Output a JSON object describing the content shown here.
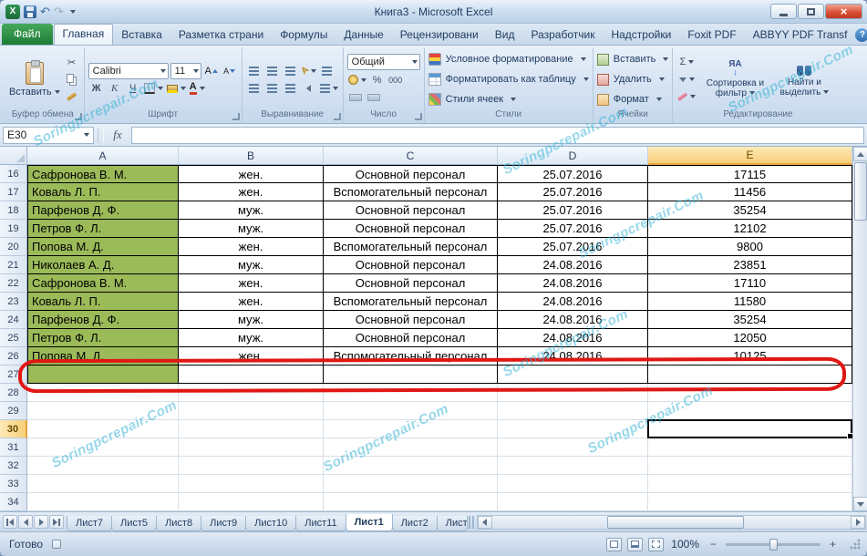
{
  "window": {
    "title": "Книга3  -  Microsoft Excel"
  },
  "icons": {
    "dropdown": "▾",
    "scissors": "✂",
    "undo": "↶",
    "redo": "↷",
    "close": "×",
    "help": "?",
    "sum": "Σ",
    "percent": "%",
    "zeros": "000",
    "letter_a": "А",
    "sort_letters": "ЯА",
    "down_arrow": "↓",
    "fx": "fx",
    "minus": "−",
    "plus": "+",
    "excel_x": "X"
  },
  "ribbon": {
    "tabs": [
      {
        "label": "Файл",
        "type": "file"
      },
      {
        "label": "Главная",
        "active": true
      },
      {
        "label": "Вставка"
      },
      {
        "label": "Разметка страни"
      },
      {
        "label": "Формулы"
      },
      {
        "label": "Данные"
      },
      {
        "label": "Рецензировани"
      },
      {
        "label": "Вид"
      },
      {
        "label": "Разработчик"
      },
      {
        "label": "Надстройки"
      },
      {
        "label": "Foxit PDF"
      },
      {
        "label": "ABBYY PDF Transf"
      }
    ],
    "clipboard": {
      "label": "Буфер обмена",
      "paste": "Вставить"
    },
    "font": {
      "label": "Шрифт",
      "family": "Calibri",
      "size": "11",
      "bold": "Ж",
      "italic": "К",
      "underline": "Ч"
    },
    "alignment": {
      "label": "Выравнивание"
    },
    "number": {
      "label": "Число",
      "format": "Общий"
    },
    "styles": {
      "label": "Стили",
      "conditional": "Условное форматирование",
      "as_table": "Форматировать как таблицу",
      "cell_styles": "Стили ячеек"
    },
    "cells": {
      "label": "Ячейки",
      "insert": "Вставить",
      "delete": "Удалить",
      "format": "Формат"
    },
    "editing": {
      "label": "Редактирование",
      "sort": "Сортировка и фильтр",
      "find": "Найти и выделить"
    }
  },
  "formula_bar": {
    "name_box": "E30",
    "value": ""
  },
  "sheet": {
    "columns": [
      "A",
      "B",
      "C",
      "D",
      "E"
    ],
    "first_row": 16,
    "last_row": 34,
    "selected_cell": "E30",
    "selected_column": "E",
    "selected_row": 30,
    "table_last_row": 27,
    "highlighted_empty_row": 27,
    "green_fill_color": "#9bbb59",
    "annotation_color": "#e01713",
    "rows": [
      {
        "row": 16,
        "cells": [
          "Сафронова В. М.",
          "жен.",
          "Основной персонал",
          "25.07.2016",
          "17115"
        ]
      },
      {
        "row": 17,
        "cells": [
          "Коваль Л. П.",
          "жен.",
          "Вспомогательный персонал",
          "25.07.2016",
          "11456"
        ]
      },
      {
        "row": 18,
        "cells": [
          "Парфенов Д. Ф.",
          "муж.",
          "Основной персонал",
          "25.07.2016",
          "35254"
        ]
      },
      {
        "row": 19,
        "cells": [
          "Петров Ф. Л.",
          "муж.",
          "Основной персонал",
          "25.07.2016",
          "12102"
        ]
      },
      {
        "row": 20,
        "cells": [
          "Попова М. Д.",
          "жен.",
          "Вспомогательный персонал",
          "25.07.2016",
          "9800"
        ]
      },
      {
        "row": 21,
        "cells": [
          "Николаев А. Д.",
          "муж.",
          "Основной персонал",
          "24.08.2016",
          "23851"
        ]
      },
      {
        "row": 22,
        "cells": [
          "Сафронова В. М.",
          "жен.",
          "Основной персонал",
          "24.08.2016",
          "17110"
        ]
      },
      {
        "row": 23,
        "cells": [
          "Коваль Л. П.",
          "жен.",
          "Вспомогательный персонал",
          "24.08.2016",
          "11580"
        ]
      },
      {
        "row": 24,
        "cells": [
          "Парфенов Д. Ф.",
          "муж.",
          "Основной персонал",
          "24.08.2016",
          "35254"
        ]
      },
      {
        "row": 25,
        "cells": [
          "Петров Ф. Л.",
          "муж.",
          "Основной персонал",
          "24.08.2016",
          "12050"
        ]
      },
      {
        "row": 26,
        "cells": [
          "Попова М. Д.",
          "жен.",
          "Вспомогательный персонал",
          "24.08.2016",
          "10125"
        ]
      }
    ]
  },
  "sheet_tabs": {
    "names": [
      "Лист7",
      "Лист5",
      "Лист8",
      "Лист9",
      "Лист10",
      "Лист11",
      "Лист1",
      "Лист2",
      "Лист"
    ],
    "active": "Лист1"
  },
  "status_bar": {
    "mode": "Готово",
    "zoom": "100%"
  },
  "watermark": {
    "text": "Soringpcrepair.Com",
    "color": "#2fb0d4"
  }
}
